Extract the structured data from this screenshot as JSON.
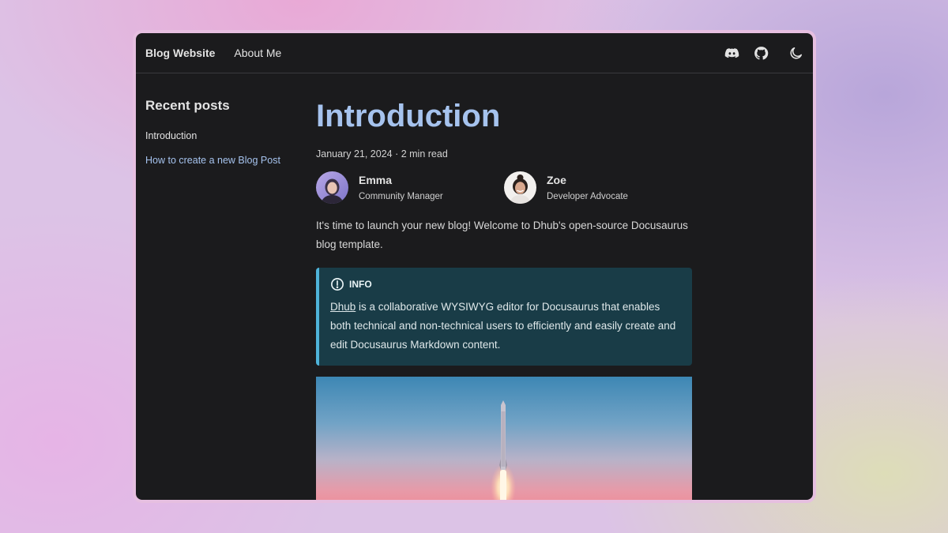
{
  "navbar": {
    "brand": "Blog Website",
    "links": [
      "About Me"
    ],
    "icons": [
      "discord-icon",
      "github-icon",
      "moon-icon"
    ]
  },
  "sidebar": {
    "title": "Recent posts",
    "items": [
      {
        "label": "Introduction",
        "active": true
      },
      {
        "label": "How to create a new Blog Post",
        "active": false
      }
    ]
  },
  "post": {
    "title": "Introduction",
    "meta": "January 21, 2024 · 2 min read",
    "authors": [
      {
        "name": "Emma",
        "role": "Community Manager"
      },
      {
        "name": "Zoe",
        "role": "Developer Advocate"
      }
    ],
    "intro": "It's time to launch your new blog! Welcome to Dhub's open-source Docusaurus blog template.",
    "admonition": {
      "label": "INFO",
      "link_text": "Dhub",
      "body": " is a collaborative WYSIWYG editor for Docusaurus that enables both technical and non-technical users to efficiently and easily create and edit Docusaurus Markdown content."
    }
  },
  "colors": {
    "title": "#a6c3ee",
    "link": "#a6c3ee",
    "admonition_bg": "#193c47",
    "admonition_border": "#4fb3d9",
    "window_bg": "#1b1b1d"
  }
}
